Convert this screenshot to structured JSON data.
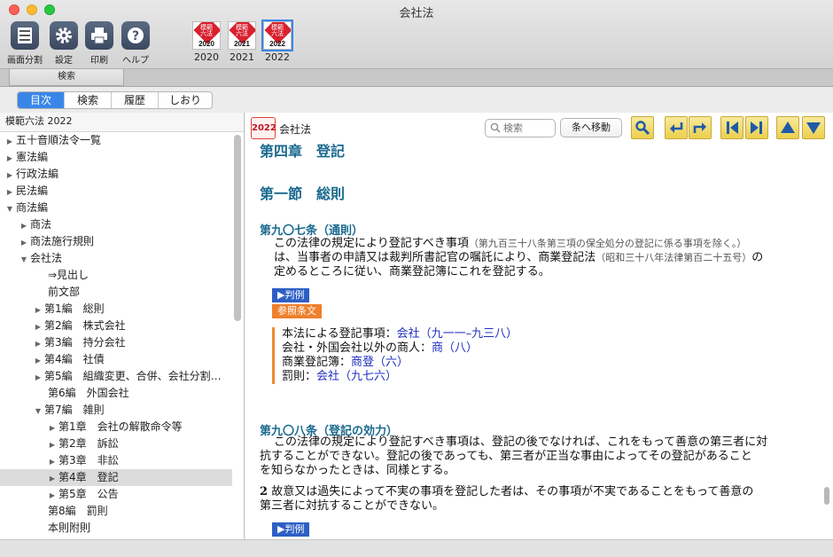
{
  "window": {
    "title": "会社法"
  },
  "toolbar": {
    "split": "画面分割",
    "settings": "設定",
    "print": "印刷",
    "help": "ヘルプ",
    "books": [
      {
        "year": "2020",
        "cover_text": "模範\n六法"
      },
      {
        "year": "2021",
        "cover_text": "模範\n六法"
      },
      {
        "year": "2022",
        "cover_text": "模範\n六法"
      }
    ]
  },
  "search_tab": {
    "label": "検索"
  },
  "segments": [
    "目次",
    "検索",
    "履歴",
    "しおり"
  ],
  "sidebar": {
    "header": "模範六法 2022",
    "tree": [
      {
        "label": "五十音順法令一覧",
        "level": 0,
        "toggle": "closed"
      },
      {
        "label": "憲法編",
        "level": 0,
        "toggle": "closed"
      },
      {
        "label": "行政法編",
        "level": 0,
        "toggle": "closed"
      },
      {
        "label": "民法編",
        "level": 0,
        "toggle": "closed"
      },
      {
        "label": "商法編",
        "level": 0,
        "toggle": "open"
      },
      {
        "label": "商法",
        "level": 1,
        "toggle": "closed"
      },
      {
        "label": "商法施行規則",
        "level": 1,
        "toggle": "closed"
      },
      {
        "label": "会社法",
        "level": 1,
        "toggle": "open"
      },
      {
        "label": "⇒見出し",
        "level": 2,
        "toggle": "none"
      },
      {
        "label": "前文部",
        "level": 2,
        "toggle": "none"
      },
      {
        "label": "第1編　総則",
        "level": 2,
        "toggle": "closed"
      },
      {
        "label": "第2編　株式会社",
        "level": 2,
        "toggle": "closed"
      },
      {
        "label": "第3編　持分会社",
        "level": 2,
        "toggle": "closed"
      },
      {
        "label": "第4編　社債",
        "level": 2,
        "toggle": "closed"
      },
      {
        "label": "第5編　組織変更、合併、会社分割…",
        "level": 2,
        "toggle": "closed"
      },
      {
        "label": "第6編　外国会社",
        "level": 2,
        "toggle": "none"
      },
      {
        "label": "第7編　雑則",
        "level": 2,
        "toggle": "open"
      },
      {
        "label": "第1章　会社の解散命令等",
        "level": 3,
        "toggle": "closed"
      },
      {
        "label": "第2章　訴訟",
        "level": 3,
        "toggle": "closed"
      },
      {
        "label": "第3章　非訟",
        "level": 3,
        "toggle": "closed"
      },
      {
        "label": "第4章　登記",
        "level": 3,
        "toggle": "closed",
        "selected": true
      },
      {
        "label": "第5章　公告",
        "level": 3,
        "toggle": "closed"
      },
      {
        "label": "第8編　罰則",
        "level": 2,
        "toggle": "none"
      },
      {
        "label": "本則附則",
        "level": 2,
        "toggle": "none"
      }
    ]
  },
  "main": {
    "badge": "2022",
    "title": "会社法",
    "search_placeholder": "検索",
    "goto_label": "条へ移動",
    "chapter": "第四章　登記",
    "section": "第一節　総則",
    "art907": {
      "heading": "第九〇七条（通則）",
      "line1_main": "この法律の規定により登記すべき事項",
      "line1_note": "（第九百三十八条第三項の保全処分の登記に係る事項を除く。）",
      "line2_main": "は、当事者の申請又は裁判所書記官の嘱託により、商業登記法",
      "line2_note": "（昭和三十八年法律第百二十五号）",
      "line2_tail": "の",
      "line3": "定めるところに従い、商業登記簿にこれを登記する。"
    },
    "hanrei_label": "▶判例",
    "sanshou_label": "参照条文",
    "refs": [
      {
        "text": "本法による登記事項：",
        "link": "会社（九一一–九三八）"
      },
      {
        "text": "会社・外国会社以外の商人：",
        "link": "商（八）"
      },
      {
        "text": "商業登記簿：",
        "link": "商登（六）"
      },
      {
        "text": "罰則：",
        "link": "会社（九七六）"
      }
    ],
    "art908": {
      "heading": "第九〇八条（登記の効力）",
      "p1_line1": "この法律の規定により登記すべき事項は、登記の後でなければ、これをもって善意の第三者に対",
      "p1_line2": "抗することができない。登記の後であっても、第三者が正当な事由によってその登記があること",
      "p1_line3": "を知らなかったときは、同様とする。",
      "p2_num": "2",
      "p2_line1": "故意又は過失によって不実の事項を登記した者は、その事項が不実であることをもって善意の",
      "p2_line2": "第三者に対抗することができない。"
    }
  },
  "colors": {
    "accent": "#3a86e8",
    "heading": "#1b6a8f",
    "tag_blue": "#2d5fc4",
    "tag_orange": "#ee7f2b",
    "link": "#1f2fbf"
  }
}
